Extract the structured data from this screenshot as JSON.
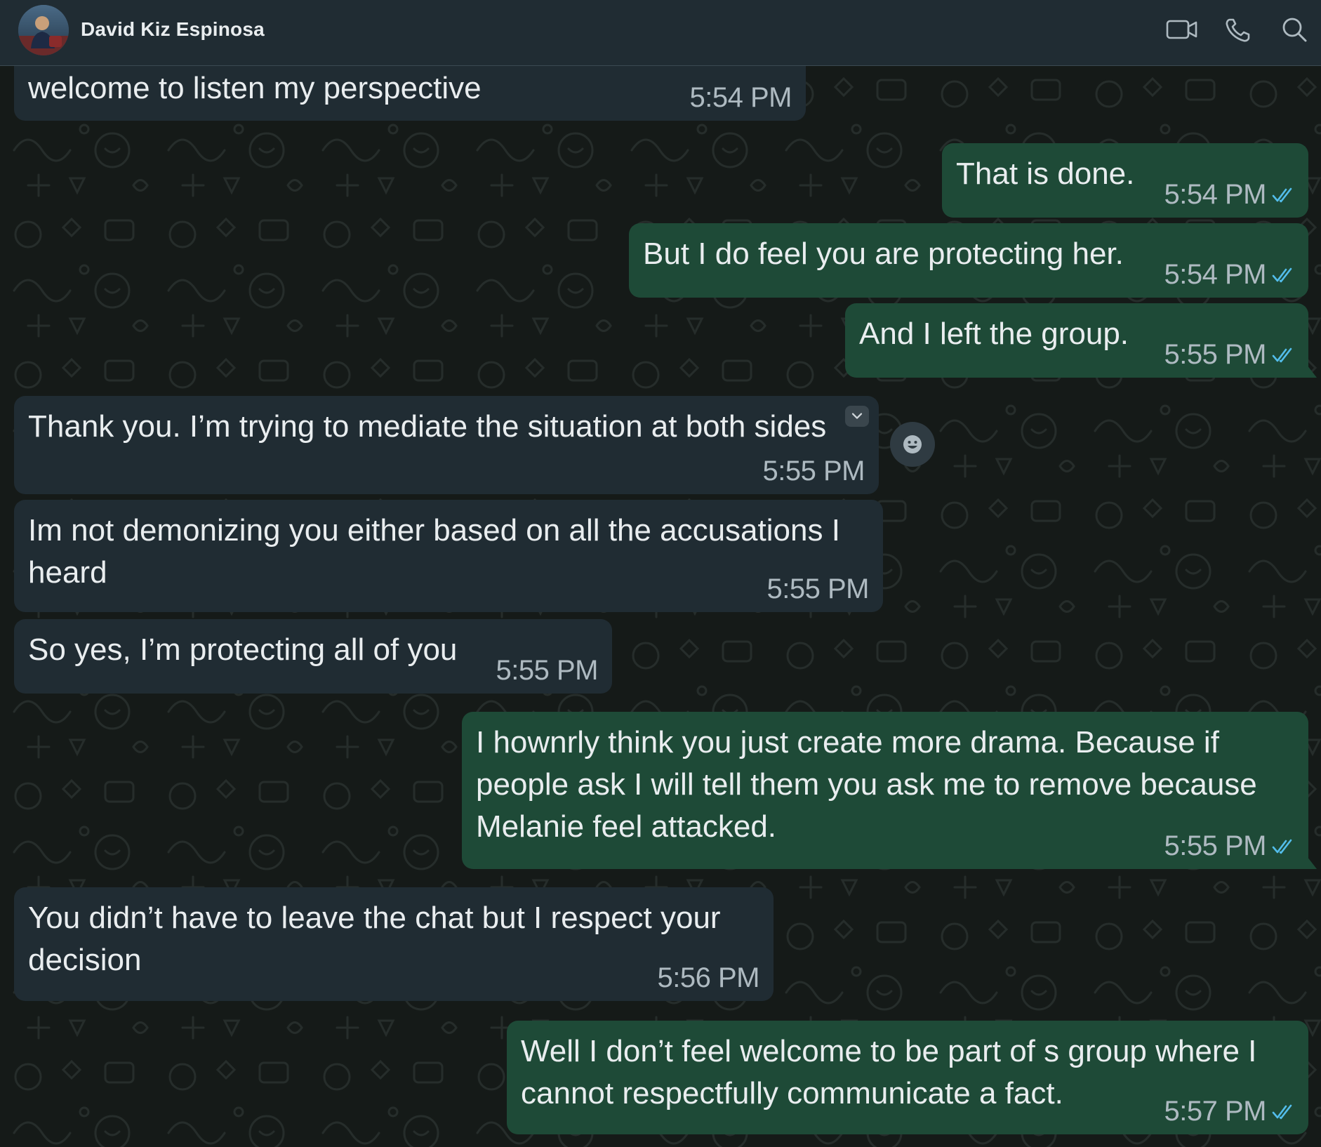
{
  "header": {
    "contact_name": "David Kiz Espinosa",
    "icons": [
      "video-call-icon",
      "voice-call-icon",
      "search-icon"
    ]
  },
  "colors": {
    "header_bg": "#202c33",
    "incoming_bubble": "#202c33",
    "outgoing_bubble": "#1e4a37",
    "read_receipt": "#53bdeb",
    "timestamp": "#aebac1"
  },
  "messages": [
    {
      "direction": "in",
      "text": "welcome to listen my perspective",
      "time": "5:54 PM"
    },
    {
      "direction": "out",
      "text": "That is done.",
      "time": "5:54 PM",
      "status": "read"
    },
    {
      "direction": "out",
      "text": "But I do feel you are protecting her.",
      "time": "5:54 PM",
      "status": "read"
    },
    {
      "direction": "out",
      "text": "And I left the group.",
      "time": "5:55 PM",
      "status": "read"
    },
    {
      "direction": "in",
      "text": "Thank you. I’m trying to mediate the situation at both sides",
      "time": "5:55 PM"
    },
    {
      "direction": "in",
      "text": "Im not demonizing you either based on all the accusations I heard",
      "time": "5:55 PM"
    },
    {
      "direction": "in",
      "text": "So yes, I’m protecting all of you",
      "time": "5:55 PM"
    },
    {
      "direction": "out",
      "text": "I hownrly think you just create more drama. Because if people ask I will tell them you ask me to remove because Melanie feel attacked.",
      "time": "5:55 PM",
      "status": "read"
    },
    {
      "direction": "in",
      "text": "You didn’t have to leave the chat but I respect your decision",
      "time": "5:56 PM"
    },
    {
      "direction": "out",
      "text": "Well I don’t feel welcome to be part of s group where I cannot respectfully communicate a fact.",
      "time": "5:57 PM",
      "status": "read"
    }
  ]
}
